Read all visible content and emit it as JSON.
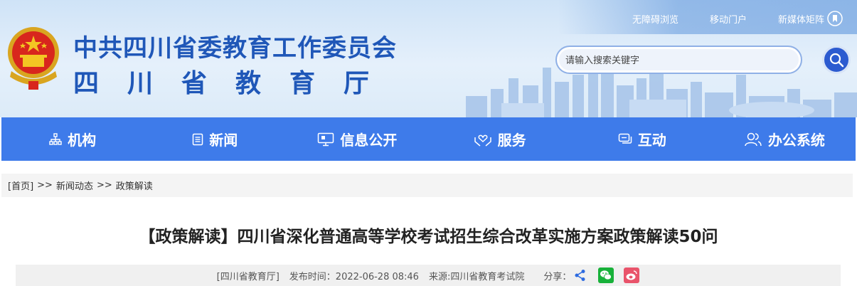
{
  "header": {
    "title_line1": "中共四川省委教育工作委员会",
    "title_line2": "四川省教育厅",
    "top_links": [
      "无障碍浏览",
      "移动门户",
      "新媒体矩阵"
    ],
    "search_placeholder": "请输入搜索关键字",
    "search_icon": "search-icon",
    "emblem_icon": "national-emblem-icon"
  },
  "nav": {
    "items": [
      {
        "label": "机构",
        "icon": "org-chart-icon"
      },
      {
        "label": "新闻",
        "icon": "document-icon"
      },
      {
        "label": "信息公开",
        "icon": "monitor-icon"
      },
      {
        "label": "服务",
        "icon": "hands-heart-icon"
      },
      {
        "label": "互动",
        "icon": "chat-icon"
      },
      {
        "label": "办公系统",
        "icon": "users-icon"
      }
    ],
    "background_color": "#3e7bea"
  },
  "breadcrumb": {
    "home": "[首页]",
    "separator": ">>",
    "level1": "新闻动态",
    "level2": "政策解读"
  },
  "article": {
    "title": "【政策解读】四川省深化普通高等学校考试招生综合改革实施方案政策解读50问",
    "source_tag": "[四川省教育厅]",
    "publish_time": "发布时间：2022-06-28 08:46",
    "origin": "来源:四川省教育考试院",
    "share_label": "分享："
  },
  "colors": {
    "title_blue": "#1f57b8",
    "search_button": "#2c5bd0",
    "wechat_green": "#18b13a",
    "weibo_red": "#e9546b"
  }
}
